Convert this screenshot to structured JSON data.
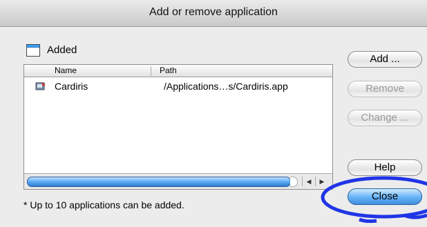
{
  "window": {
    "title": "Add or remove application"
  },
  "list": {
    "label": "Added",
    "columns": {
      "name": "Name",
      "path": "Path"
    },
    "rows": [
      {
        "name": "Cardiris",
        "path": "/Applications…s/Cardiris.app",
        "icon": "app-icon"
      }
    ]
  },
  "buttons": {
    "add": "Add ...",
    "remove": "Remove",
    "change": "Change ...",
    "help": "Help",
    "close": "Close"
  },
  "footnote": "* Up to 10 applications can be added.",
  "colors": {
    "highlight_circle": "#1f35e6",
    "accent": "#3f8ee0"
  }
}
